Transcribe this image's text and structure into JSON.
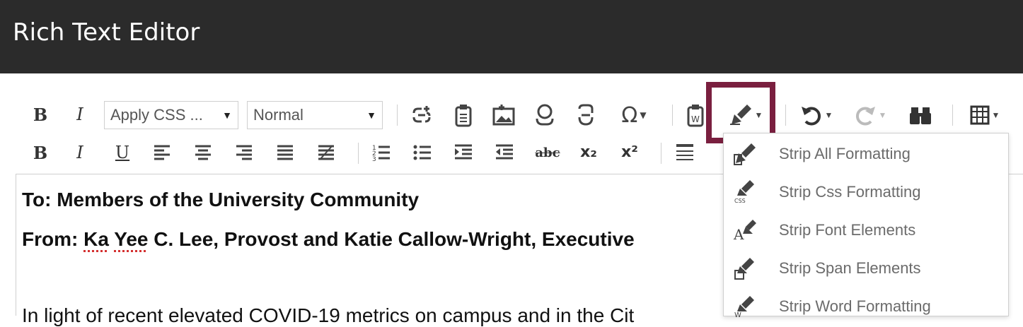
{
  "window": {
    "title": "Rich Text Editor"
  },
  "toolbar": {
    "row1": {
      "bold": "B",
      "italic": "I",
      "css_select": "Apply CSS ...",
      "format_select": "Normal",
      "special_char": "Ω"
    },
    "row2": {
      "bold": "B",
      "italic": "I",
      "underline": "U",
      "strikethrough": "abc",
      "subscript": "x₂",
      "superscript": "x²"
    }
  },
  "editor": {
    "line1": "To: Members of the University Community",
    "line2_prefix": "From: ",
    "line2_name1": "Ka",
    "line2_name2": "Yee",
    "line2_rest": " C. Lee, Provost and Katie Callow-Wright, Executive",
    "line3": "In light of recent elevated COVID-19 metrics on campus and in the Cit"
  },
  "strip_menu": {
    "items": [
      {
        "label": "Strip All Formatting",
        "icon": "strip-all-icon"
      },
      {
        "label": "Strip Css Formatting",
        "icon": "strip-css-icon"
      },
      {
        "label": "Strip Font Elements",
        "icon": "strip-font-icon"
      },
      {
        "label": "Strip Span Elements",
        "icon": "strip-span-icon"
      },
      {
        "label": "Strip Word Formatting",
        "icon": "strip-word-icon"
      }
    ]
  },
  "colors": {
    "titlebar": "#2b2b2b",
    "highlight": "#7a1f3f"
  }
}
